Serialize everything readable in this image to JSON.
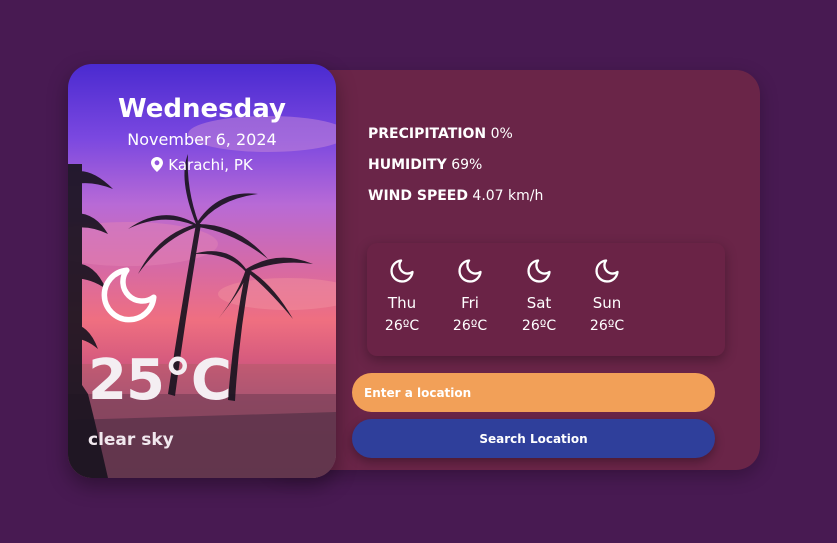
{
  "today": {
    "day": "Wednesday",
    "date": "November 6, 2024",
    "location": "Karachi, PK",
    "temperature": "25°C",
    "description": "clear sky",
    "icon": "moon-icon"
  },
  "stats": [
    {
      "label": "PRECIPITATION",
      "value": "0%"
    },
    {
      "label": "HUMIDITY",
      "value": "69%"
    },
    {
      "label": "WIND SPEED",
      "value": "4.07 km/h"
    }
  ],
  "forecast": [
    {
      "day": "Thu",
      "temp": "26ºC",
      "icon": "moon-icon"
    },
    {
      "day": "Fri",
      "temp": "26ºC",
      "icon": "moon-icon"
    },
    {
      "day": "Sat",
      "temp": "26ºC",
      "icon": "moon-icon"
    },
    {
      "day": "Sun",
      "temp": "26ºC",
      "icon": "moon-icon"
    }
  ],
  "search": {
    "placeholder": "Enter a location",
    "value": "",
    "button_label": "Search Location"
  },
  "colors": {
    "page_background": "#481a52",
    "panel": "#6a2548",
    "input_accent": "#f2a058",
    "button_accent": "#2f3f9b"
  }
}
